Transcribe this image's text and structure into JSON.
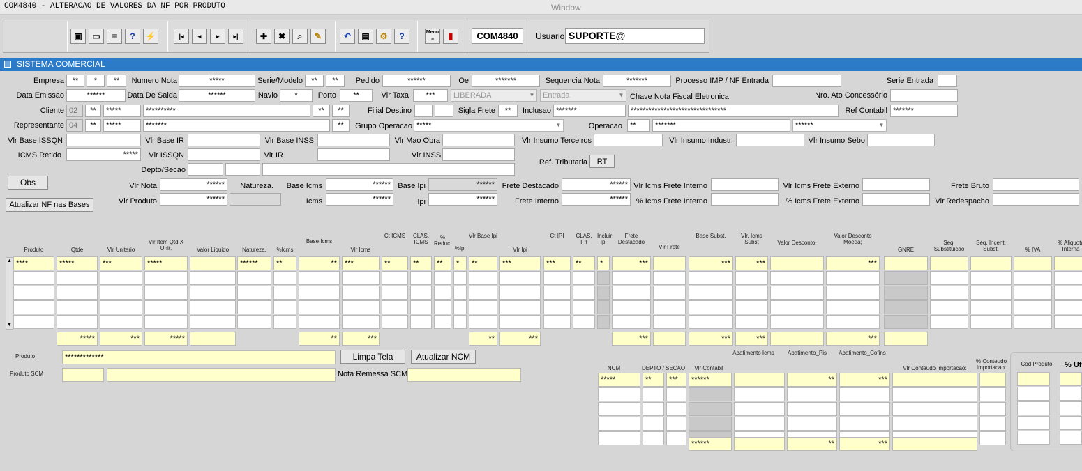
{
  "window": {
    "app_title": "COM4840 - ALTERACAO DE VALORES DA NF POR PRODUTO",
    "title": "Window"
  },
  "toolbar": {
    "form_code": "COM4840",
    "usuario_label": "Usuario",
    "usuario_value": "SUPORTE@",
    "icons": [
      "save-icon",
      "window-icon",
      "print-icon",
      "help-query-icon",
      "magic-icon",
      "first-record-icon",
      "prev-record-icon",
      "next-record-icon",
      "last-record-icon",
      "insert-record-icon",
      "delete-record-icon",
      "search-icon",
      "clear-icon",
      "undo-icon",
      "clipboard-icon",
      "tools-icon",
      "help-icon",
      "menu-icon",
      "exit-icon"
    ]
  },
  "section": {
    "title": "SISTEMA COMERCIAL"
  },
  "header": {
    "empresa_label": "Empresa",
    "empresa": [
      "**",
      "*",
      "**"
    ],
    "numero_nota_label": "Numero Nota",
    "numero_nota": "*****",
    "serie_modelo_label": "Serie/Modelo",
    "serie_modelo": [
      "**",
      "**"
    ],
    "pedido_label": "Pedido",
    "pedido": "******",
    "oe_label": "Oe",
    "oe": "*******",
    "sequencia_nota_label": "Sequencia Nota",
    "sequencia_nota": "*******",
    "processo_label": "Processo IMP / NF Entrada",
    "processo": "",
    "serie_entrada_label": "Serie Entrada",
    "serie_entrada": "",
    "data_emissao_label": "Data Emissao",
    "data_emissao": "******",
    "data_saida_label": "Data De Saida",
    "data_saida": "******",
    "navio_label": "Navio",
    "navio": "*",
    "porto_label": "Porto",
    "porto": "**",
    "vlr_taxa_label": "Vlr Taxa",
    "vlr_taxa": "***",
    "status_select": "LIBERADA",
    "tipo_select": "Entrada",
    "chave_label": "Chave Nota Fiscal Eletronica",
    "nro_ato_label": "Nro. Ato Concessório",
    "nro_ato": "",
    "cliente_label": "Cliente",
    "cliente": [
      "02",
      "**",
      "*****",
      "**********",
      "**",
      "**"
    ],
    "filial_destino_label": "Filial Destino",
    "sigla_frete_label": "Sigla Frete",
    "sigla_frete": "**",
    "inclusao_label": "Inclusao",
    "inclusao": "*******",
    "chave_value": "********************************",
    "ref_contabil_label": "Ref Contabil",
    "ref_contabil": "*******",
    "representante_label": "Representante",
    "representante": [
      "04",
      "**",
      "*****",
      "*******",
      "**"
    ],
    "grupo_operacao_label": "Grupo Operacao",
    "grupo_operacao": "*****",
    "operacao_label": "Operacao",
    "operacao": [
      "**",
      "*******",
      "******"
    ],
    "vlr_base_issqn_label": "Vlr Base ISSQN",
    "vlr_base_ir_label": "Vlr Base IR",
    "vlr_base_inss_label": "Vlr Base INSS",
    "vlr_mao_obra_label": "Vlr Mao Obra",
    "vlr_insumo_terceiros_label": "Vlr Insumo Terceiros",
    "vlr_insumo_industr_label": "Vlr Insumo Industr.",
    "vlr_insumo_sebo_label": "Vlr Insumo Sebo",
    "icms_retido_label": "ICMS Retido",
    "icms_retido": "*****",
    "vlr_issqn_label": "Vlr ISSQN",
    "vlr_ir_label": "Vlr IR",
    "vlr_inss_label": "Vlr INSS",
    "depto_secao_label": "Depto/Secao",
    "ref_tributaria_label": "Ref. Tributaria",
    "ref_tributaria_button": "RT",
    "obs_button": "Obs",
    "atualizar_nf_button": "Atualizar NF nas Bases",
    "vlr_nota_label": "Vlr Nota",
    "vlr_nota": "******",
    "natureza_label": "Natureza.",
    "base_icms_label": "Base Icms",
    "base_icms": "******",
    "base_ipi_label": "Base Ipi",
    "base_ipi": "******",
    "frete_destacado_label": "Frete Destacado",
    "frete_destacado": "******",
    "vlr_icms_frete_interno_label": "Vlr Icms Frete Interno",
    "vlr_icms_frete_externo_label": "Vlr Icms Frete Externo",
    "frete_bruto_label": "Frete Bruto",
    "vlr_produto_label": "Vlr Produto",
    "vlr_produto": "******",
    "icms_label": "Icms",
    "icms": "******",
    "ipi_label": "Ipi",
    "ipi": "******",
    "frete_interno_label": "Frete Interno",
    "frete_interno": "******",
    "pct_icms_frete_interno_label": "% Icms Frete Interno",
    "pct_icms_frete_externo_label": "% Icms Frete Externo",
    "vlr_redespacho_label": "Vlr.Redespacho"
  },
  "grid": {
    "columns": [
      "Produto",
      "Qtde",
      "Vlr Unitario",
      "Vlr Item Qtd X Unit.",
      "Valor  Liquido",
      "Natureza.",
      "%Icms",
      "Base Icms",
      "Vlr Icms",
      "Ct ICMS",
      "CLAS. ICMS",
      "% Reduc.",
      "%Ipi",
      "Vlr Base Ipi",
      "Vlr Ipi",
      "Ct IPI",
      "CLAS. IPI",
      "Incluir Ipi",
      "Frete Destacado",
      "Vlr Frete",
      "Base Subst.",
      "Vlr. Icms Subst",
      "Valor Desconto:",
      "Valor Desconto Moeda;",
      "GNRE",
      "Seq. Substituicao",
      "Seq. Incent. Subst.",
      "% IVA",
      "% Aliquota Interna"
    ],
    "row1": {
      "produto": "****",
      "qtde": "*****",
      "vlr_unitario": "***",
      "vlr_item": "*****",
      "natureza": "******",
      "pct_icms": "**",
      "base_icms": "**",
      "vlr_icms": "***",
      "ct_icms": "**",
      "clas_icms": "**",
      "reduc": "**",
      "pct_ipi": "*",
      "vlr_base_ipi": "**",
      "vlr_ipi": "***",
      "ct_ipi": "***",
      "clas_ipi": "**",
      "incluir_ipi": "*",
      "frete_destacado": "***",
      "base_subst": "***",
      "vlr_icms_subst": "***",
      "valor_desconto_moeda": "***"
    },
    "totals": {
      "qtde": "*****",
      "vlr_unitario": "***",
      "vlr_item": "*****",
      "base_icms": "**",
      "vlr_icms": "***",
      "vlr_base_ipi": "**",
      "vlr_ipi": "***",
      "frete_destacado": "***",
      "base_subst": "***",
      "vlr_icms_subst": "***",
      "valor_desconto_moeda": "***"
    },
    "abatimento_icms_label": "Abatimento Icms",
    "abatimento_pis_label": "Abatimento_Pis",
    "abatimento_cofins_label": "Abatimento_Cofins"
  },
  "bottom": {
    "produto_label": "Produto",
    "produto": "*************",
    "limpa_tela_button": "Limpa Tela",
    "atualizar_ncm_button": "Atualizar NCM",
    "produto_scm_label": "Produto SCM",
    "nota_remessa_scm_label": "Nota Remessa SCM",
    "ncm_label": "NCM",
    "depto_secao_label": "DEPTO / SECAO",
    "vlr_contabil_label": "Vlr Contabil",
    "vlr_conteudo_importacao_label": "Vlr Conteudo Importacao:",
    "pct_conteudo_importacao_label": "% Conteudo Importacao:",
    "ncm_row": {
      "ncm": "*****",
      "depto": "**",
      "secao": "***",
      "vlr_contabil": "******",
      "abat_pis": "**",
      "abat_cofins": "***"
    },
    "ncm_totals": {
      "vlr_contabil": "******",
      "abat_pis": "**",
      "abat_cofins": "***"
    },
    "cod_produto_label": "Cod Produto",
    "pct_uf_label": "% Uf"
  }
}
